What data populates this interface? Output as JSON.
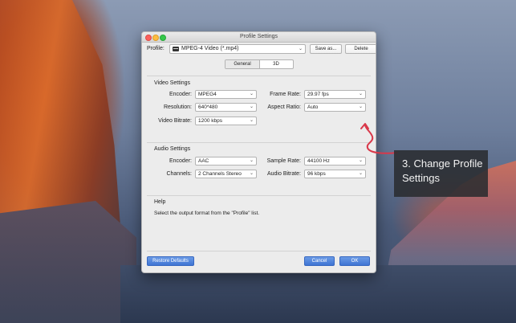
{
  "window": {
    "title": "Profile Settings"
  },
  "profile": {
    "label": "Profile:",
    "value": "MPEG-4 Video (*.mp4)",
    "save_as_label": "Save as...",
    "delete_label": "Delete"
  },
  "tabs": [
    {
      "label": "General",
      "selected": true
    },
    {
      "label": "3D",
      "selected": false
    }
  ],
  "video_settings": {
    "title": "Video Settings",
    "encoder_label": "Encoder:",
    "encoder_value": "MPEG4",
    "frame_rate_label": "Frame Rate:",
    "frame_rate_value": "29.97 fps",
    "resolution_label": "Resolution:",
    "resolution_value": "640*480",
    "aspect_ratio_label": "Aspect Ratio:",
    "aspect_ratio_value": "Auto",
    "bitrate_label": "Video Bitrate:",
    "bitrate_value": "1200 kbps"
  },
  "audio_settings": {
    "title": "Audio Settings",
    "encoder_label": "Encoder:",
    "encoder_value": "AAC",
    "sample_rate_label": "Sample Rate:",
    "sample_rate_value": "44100 Hz",
    "channels_label": "Channels:",
    "channels_value": "2 Channels Stereo",
    "bitrate_label": "Audio Bitrate:",
    "bitrate_value": "96 kbps"
  },
  "help": {
    "title": "Help",
    "text": "Select the output format from the \"Profile\" list."
  },
  "buttons": {
    "restore_defaults": "Restore Defaults",
    "cancel": "Cancel",
    "ok": "OK"
  },
  "annotation": {
    "line1": "3. Change Profile",
    "line2": "Settings"
  },
  "colors": {
    "primary_button": "#3f74d3",
    "annotation_arrow": "#d9384a"
  }
}
